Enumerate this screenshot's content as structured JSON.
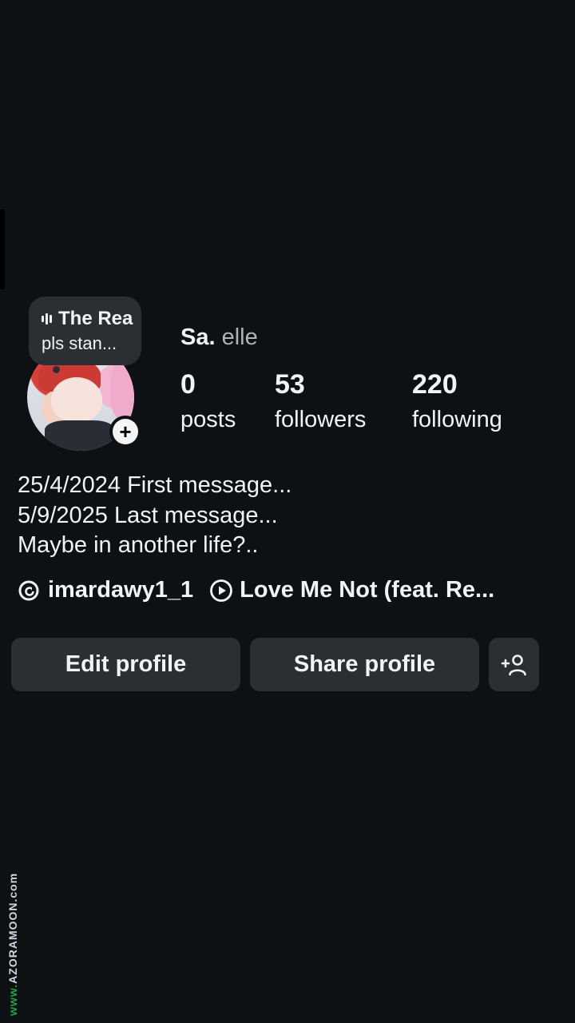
{
  "note": {
    "line1": "The Rea",
    "line2": "pls stan..."
  },
  "profile": {
    "name_bold": "Sa.",
    "name_rest": "elle"
  },
  "stats": [
    {
      "value": "0",
      "label": "posts"
    },
    {
      "value": "53",
      "label": "followers"
    },
    {
      "value": "220",
      "label": "following"
    }
  ],
  "bio": [
    "25/4/2024 First message...",
    "5/9/2025 Last message...",
    "Maybe in another life?.."
  ],
  "links": {
    "threads_handle": "imardawy1_1",
    "song": "Love Me Not (feat. Re..."
  },
  "actions": {
    "edit_label": "Edit profile",
    "share_label": "Share profile"
  },
  "watermark": {
    "prefix": "www.",
    "text": "AZORAMOON.com"
  },
  "icons": [
    "audio-bars-icon",
    "add-icon",
    "threads-icon",
    "play-circle-icon",
    "add-person-icon"
  ]
}
